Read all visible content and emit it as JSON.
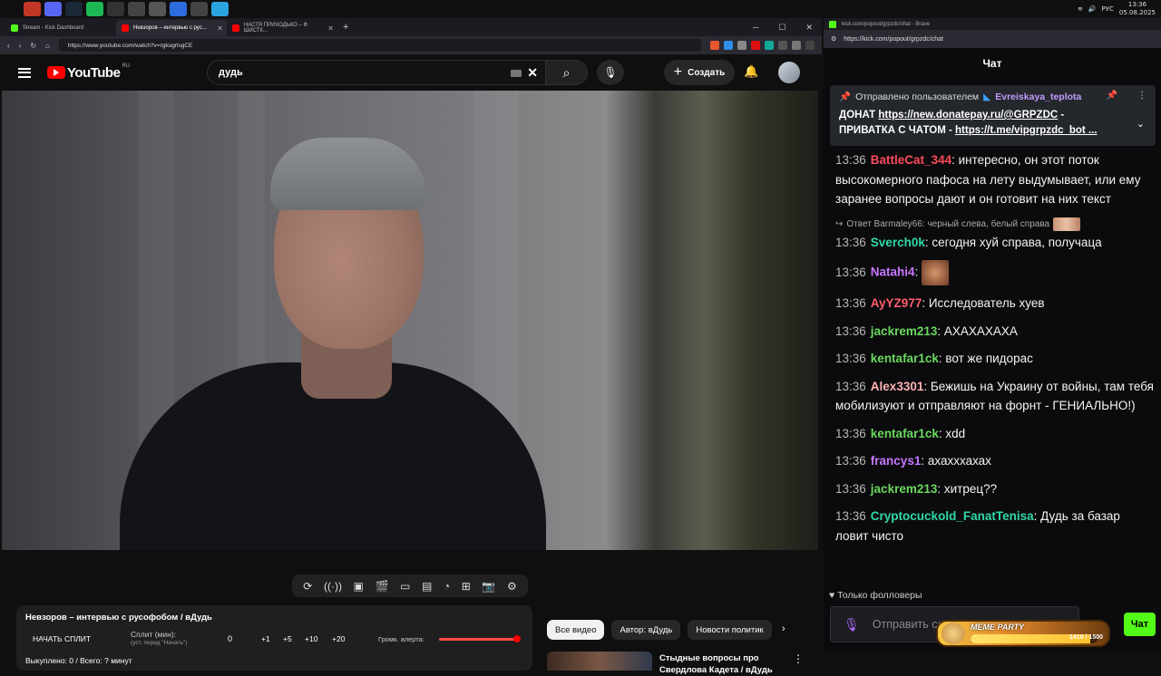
{
  "taskbar": {
    "icons": [
      {
        "icon": "firefox-icon",
        "color": "#c33626"
      },
      {
        "icon": "discord-icon",
        "color": "#5865f2"
      },
      {
        "icon": "steam-icon",
        "color": "#1b2838"
      },
      {
        "icon": "spotify-icon",
        "color": "#1db954"
      },
      {
        "icon": "obs-icon",
        "color": "#333333"
      },
      {
        "icon": "app-icon",
        "color": "#444444"
      },
      {
        "icon": "app-icon",
        "color": "#555555"
      },
      {
        "icon": "app-icon",
        "color": "#2d6cdf"
      },
      {
        "icon": "app-icon",
        "color": "#444444"
      },
      {
        "icon": "telegram-icon",
        "color": "#2aa3df"
      }
    ],
    "lang": "РУС",
    "time": "13:36",
    "date": "05.08.2025"
  },
  "browser": {
    "tabs": [
      {
        "label": "Stream - Kick Dashboard",
        "color": "#53fc18"
      },
      {
        "label": "Невзоров – интервью с рус...",
        "color": "#ff0000"
      },
      {
        "label": "НАСТЯ ПРИХОДЬКО – Ф ШИСТК...",
        "color": "#ff0000"
      }
    ],
    "url": "https://www.youtube.com/watch?v=rgkugrlsgCE"
  },
  "youtube": {
    "logo": "YouTube",
    "region": "RU",
    "search_query": "дудь",
    "create_label": "Создать",
    "brand_color": "#ff0000"
  },
  "player_controls": [
    "loop-icon",
    "broadcast-icon",
    "video-settings-icon",
    "clapper-icon",
    "frame-icon",
    "filmstrip-icon",
    "speed-icon",
    "add-clip-icon",
    "screenshot-icon",
    "gear-icon"
  ],
  "split_panel": {
    "title": "Невзоров – интервью с русофобом / вДудь",
    "start_label": "НАЧАТЬ СПЛИТ",
    "split_label": "Сплит (мин):",
    "split_hint": "(уст. перед \"Начать\")",
    "count": "0",
    "increments": [
      "+1",
      "+5",
      "+10",
      "+20"
    ],
    "volume_label": "Громк. алерта:",
    "volume_level": 1.0,
    "stats": "Выкуплено: 0 / Всего: ? минут"
  },
  "chips": [
    "Все видео",
    "Автор: вДудь",
    "Новости политик"
  ],
  "recommendation": {
    "title": "Стыдные вопросы про Свердлова Кадета / вДудь"
  },
  "chat_window": {
    "tab": "kick.com/popout/grpzdc/chat - Brave",
    "url": "https://kick.com/popout/grpzdc/chat",
    "title": "Чат",
    "pinned": {
      "prefix": "Отправлено пользователем",
      "user": "Evreiskaya_teplota",
      "text_prefix": "ДОНАТ",
      "link1": "https://new.donatepay.ru/@GRPZDC",
      "line2_prefix": "ПРИВАТКА С ЧАТОМ -",
      "link2": "https://t.me/vipgrpzdc_bot ..."
    },
    "messages": [
      {
        "time": "13:36",
        "user": "BattleCat_344",
        "color": "#ff4a5a",
        "text": "интересно, он этот поток высокомерного пафоса на лету выдумывает, или ему заранее вопросы дают и он готовит на них текст"
      },
      {
        "time": "13:36",
        "user": "Sverch0k",
        "color": "#2fd9a6",
        "text": "сегодня хуй справа, получаца",
        "reply": "Ответ Barmaley66: черный слева, белый справа"
      },
      {
        "time": "13:36",
        "user": "Natahi4",
        "color": "#c777ff",
        "text": "",
        "emote": true
      },
      {
        "time": "13:36",
        "user": "AyYZ977",
        "color": "#ff5c6c",
        "text": "Исследователь хуев"
      },
      {
        "time": "13:36",
        "user": "jackrem213",
        "color": "#6bd85f",
        "text": "АХАХАХАХА"
      },
      {
        "time": "13:36",
        "user": "kentafar1ck",
        "color": "#6bd85f",
        "text": "вот же пидорас"
      },
      {
        "time": "13:36",
        "user": "Alex3301",
        "color": "#ffb3b3",
        "text": "Бежишь на Украину от войны, там тебя мобилизуют и отправляют на форнт - ГЕНИАЛЬНО!)"
      },
      {
        "time": "13:36",
        "user": "kentafar1ck",
        "color": "#6bd85f",
        "text": "xdd"
      },
      {
        "time": "13:36",
        "user": "francys1",
        "color": "#c777ff",
        "text": "ахахххахах"
      },
      {
        "time": "13:36",
        "user": "jackrem213",
        "color": "#6bd85f",
        "text": "хитрец??"
      },
      {
        "time": "13:36",
        "user": "Cryptocuckold_FanatTenisa",
        "color": "#2fd9a6",
        "text": "Дудь за базар ловит чисто"
      }
    ],
    "followers_only": "Только фолловеры",
    "input_placeholder": "Отправить со",
    "send_label": "Чат",
    "accent": "#53fc18",
    "meme_party": {
      "name": "MEME PARTY",
      "current": 1410,
      "max": 1500,
      "label": "1410 / 1500"
    }
  }
}
